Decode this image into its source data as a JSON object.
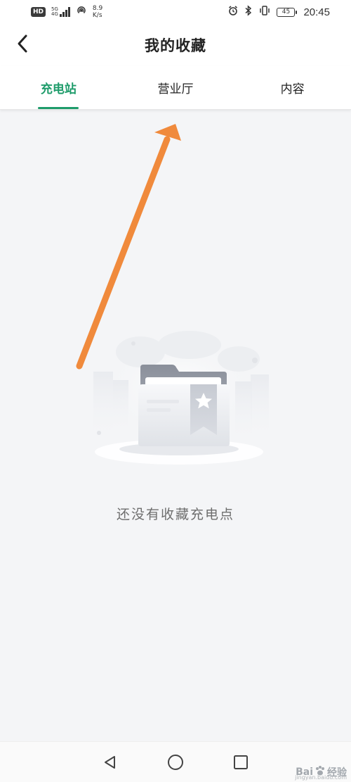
{
  "status_bar": {
    "hd": "HD",
    "signal_label": "5G",
    "signal_label2": "4G",
    "net_speed_value": "8.9",
    "net_speed_unit": "K/s",
    "battery": "45",
    "time": "20:45"
  },
  "header": {
    "title": "我的收藏"
  },
  "tabs": [
    {
      "label": "充电站",
      "active": true
    },
    {
      "label": "营业厅",
      "active": false
    },
    {
      "label": "内容",
      "active": false
    }
  ],
  "empty_state": {
    "message": "还没有收藏充电点"
  },
  "watermark": {
    "text": "Bai",
    "text2": "经验",
    "url": "jingyan.baidu.com"
  },
  "colors": {
    "accent": "#1f9c6b",
    "arrow": "#f08a3c",
    "background": "#f4f5f7"
  },
  "icons": {
    "back": "chevron-left-icon",
    "nav_back": "triangle-back-icon",
    "nav_home": "circle-home-icon",
    "nav_recent": "square-recent-icon"
  }
}
